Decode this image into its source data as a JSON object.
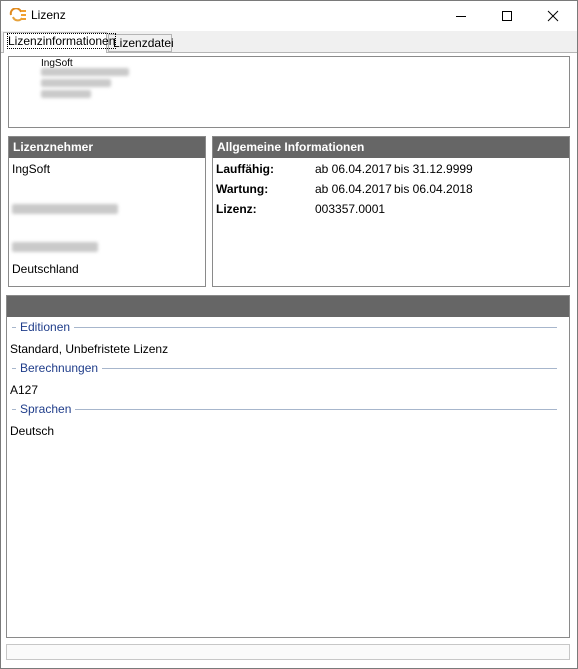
{
  "window": {
    "title": "Lizenz"
  },
  "tabs": [
    {
      "label": "Lizenzinformationen"
    },
    {
      "label": "Lizenzdatei"
    }
  ],
  "header_box": {
    "company": "IngSoft"
  },
  "licensee": {
    "heading": "Lizenznehmer",
    "name": "IngSoft",
    "country": "Deutschland"
  },
  "info": {
    "heading": "Allgemeine Informationen",
    "rows": [
      {
        "label": "Lauffähig:",
        "from": "ab 06.04.2017",
        "to": "bis 31.12.9999"
      },
      {
        "label": "Wartung:",
        "from": "ab 06.04.2017",
        "to": "bis 06.04.2018"
      },
      {
        "label": "Lizenz:",
        "from": "003357.0001",
        "to": ""
      }
    ]
  },
  "sections": [
    {
      "title": "Editionen",
      "value": "Standard, Unbefristete Lizenz"
    },
    {
      "title": "Berechnungen",
      "value": "A127"
    },
    {
      "title": "Sprachen",
      "value": "Deutsch"
    }
  ]
}
